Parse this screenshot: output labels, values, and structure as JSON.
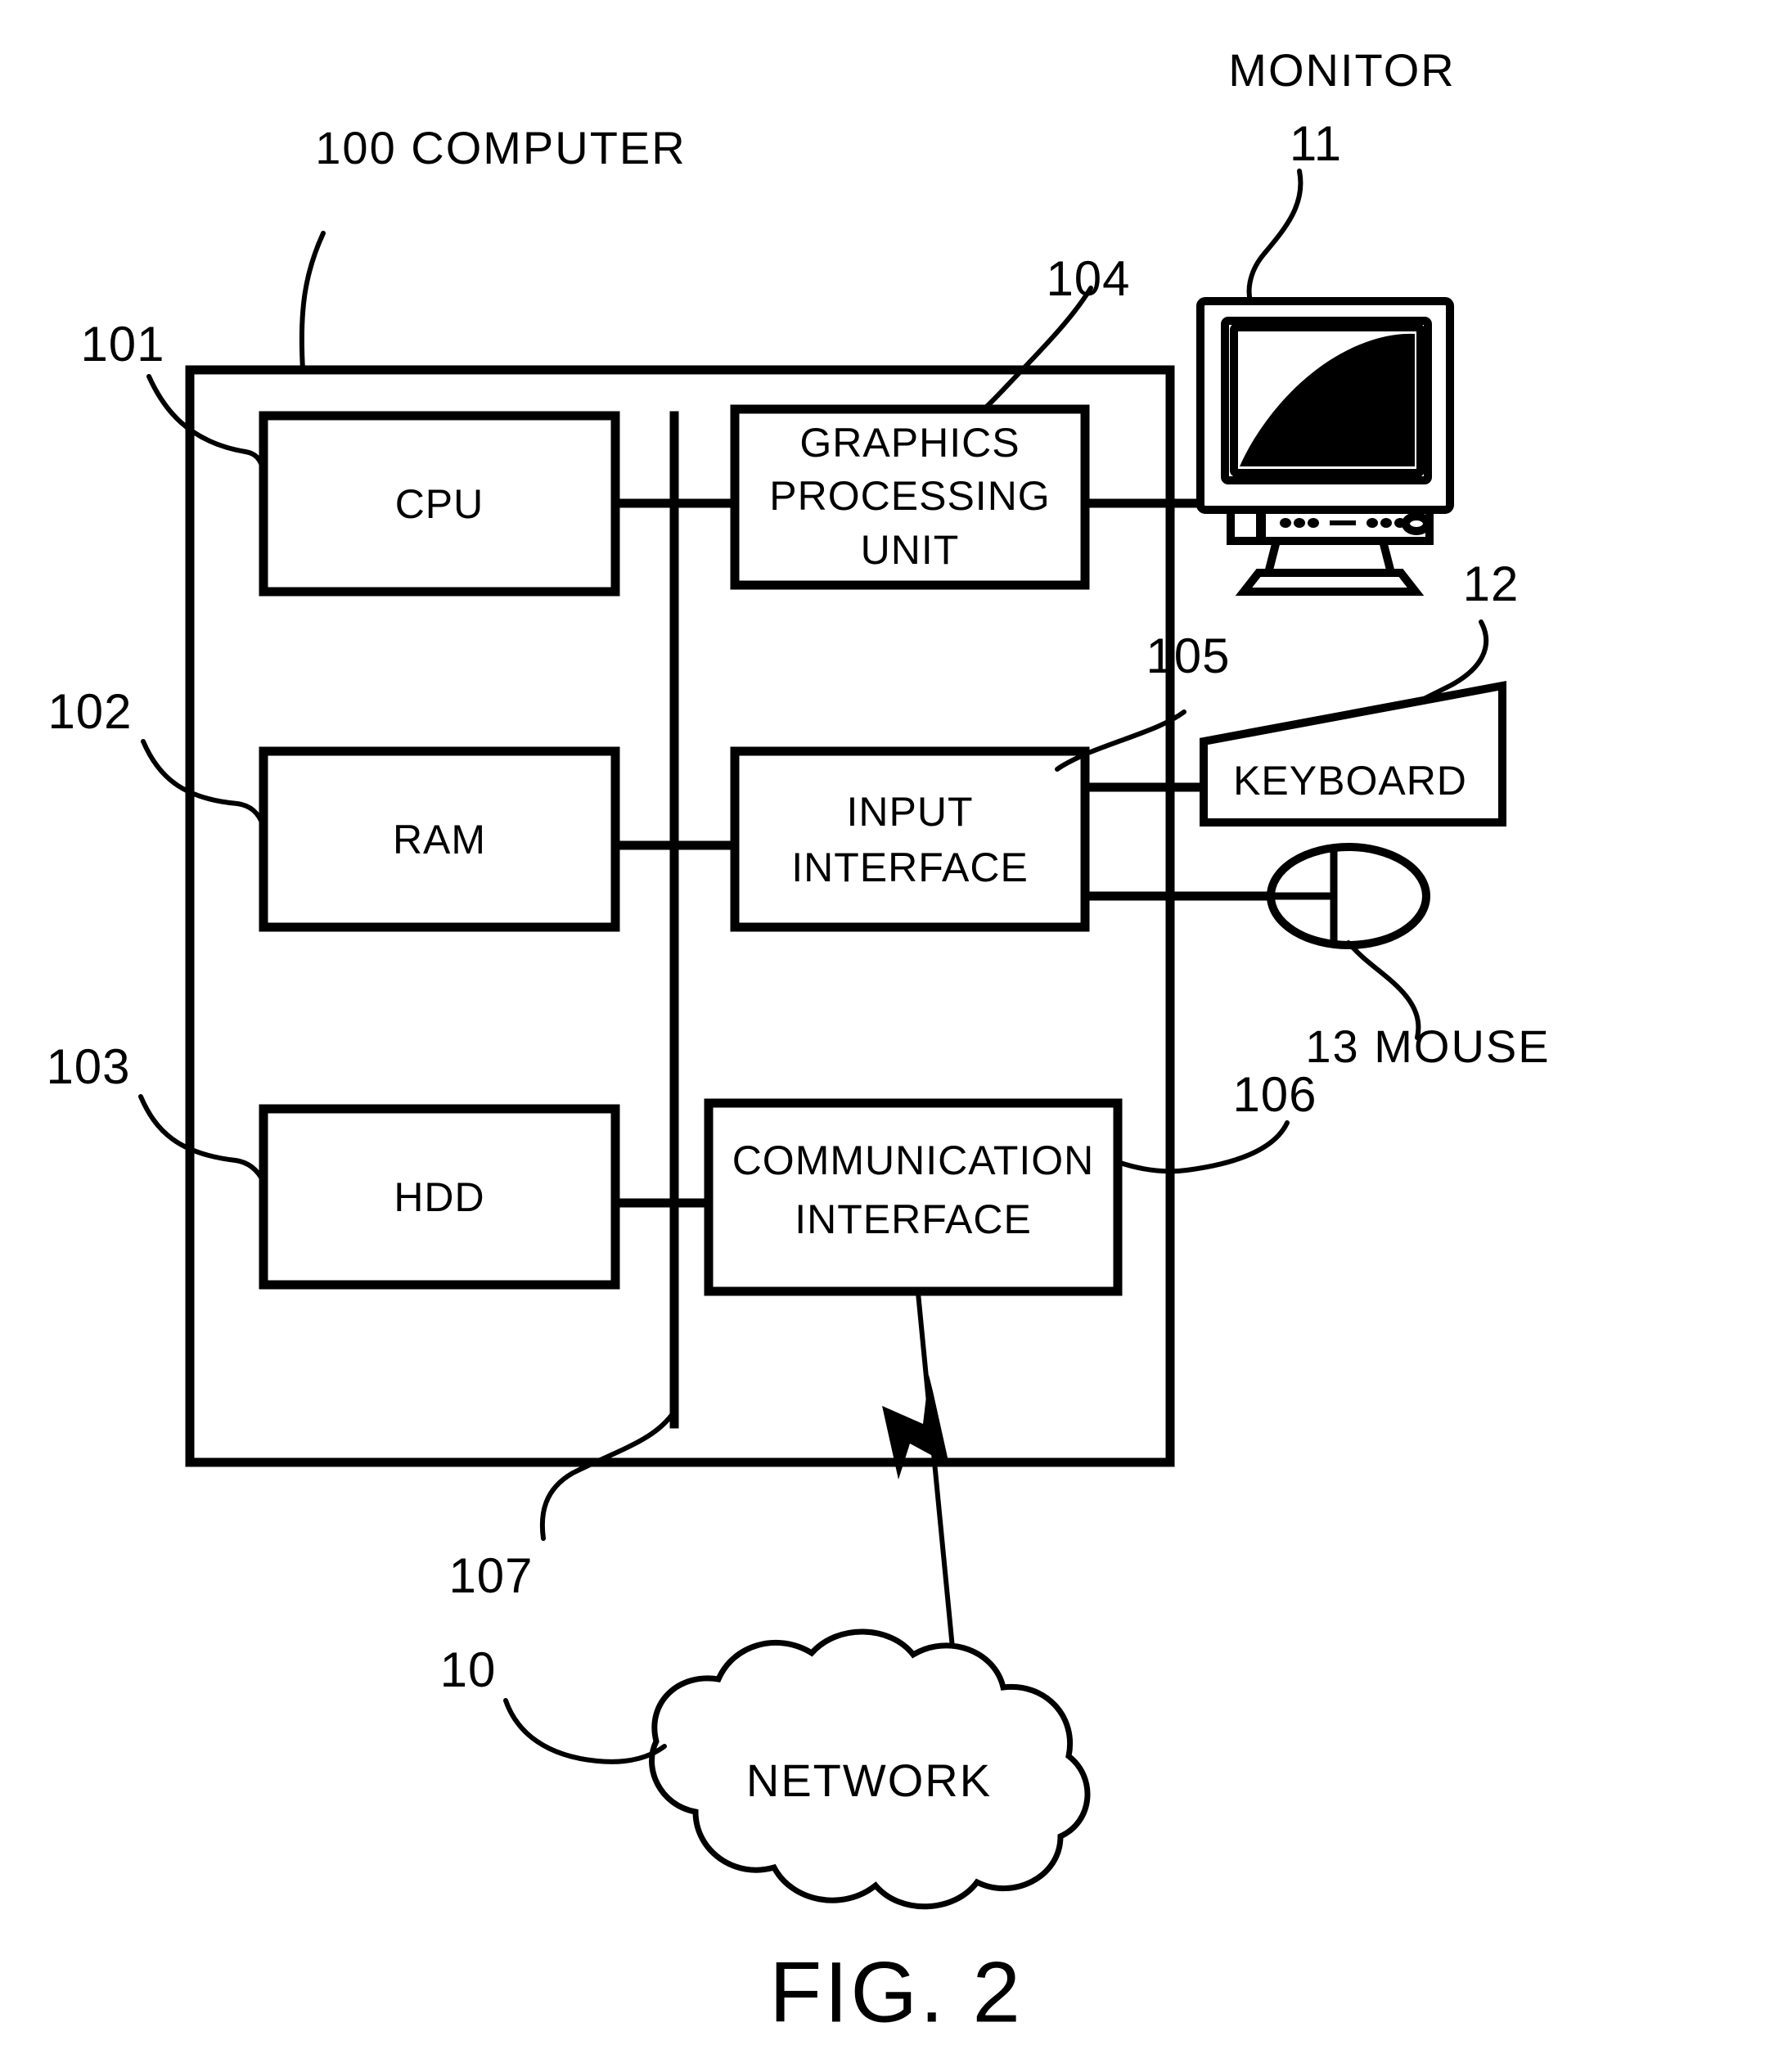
{
  "figure": {
    "caption": "FIG. 2"
  },
  "system": {
    "computer_ref": "100",
    "computer_label": "COMPUTER",
    "bus_ref": "107"
  },
  "blocks": [
    {
      "id": "cpu",
      "ref": "101",
      "label": "CPU",
      "lines": [
        "CPU"
      ]
    },
    {
      "id": "ram",
      "ref": "102",
      "label": "RAM",
      "lines": [
        "RAM"
      ]
    },
    {
      "id": "hdd",
      "ref": "103",
      "label": "HDD",
      "lines": [
        "HDD"
      ]
    },
    {
      "id": "gpu",
      "ref": "104",
      "label": "GRAPHICS PROCESSING UNIT",
      "lines": [
        "GRAPHICS",
        "PROCESSING",
        "UNIT"
      ]
    },
    {
      "id": "input",
      "ref": "105",
      "label": "INPUT INTERFACE",
      "lines": [
        "INPUT",
        "INTERFACE"
      ]
    },
    {
      "id": "comm",
      "ref": "106",
      "label": "COMMUNICATION INTERFACE",
      "lines": [
        "COMMUNICATION",
        "INTERFACE"
      ]
    }
  ],
  "peripherals": [
    {
      "id": "monitor",
      "ref": "11",
      "label": "MONITOR"
    },
    {
      "id": "keyboard",
      "ref": "12",
      "label": "KEYBOARD"
    },
    {
      "id": "mouse",
      "ref": "13",
      "label": "MOUSE"
    }
  ],
  "network": {
    "ref": "10",
    "label": "NETWORK"
  },
  "text": {
    "computer_callout": "100 COMPUTER",
    "monitor_callout": "MONITOR",
    "monitor_ref": "11",
    "keyboard_text": "KEYBOARD",
    "keyboard_ref": "12",
    "mouse_callout": "13 MOUSE",
    "network_text": "NETWORK",
    "network_ref": "10",
    "bus_ref": "107",
    "cpu_ref": "101",
    "ram_ref": "102",
    "hdd_ref": "103",
    "gpu_ref": "104",
    "input_ref": "105",
    "comm_ref": "106",
    "cpu_text": "CPU",
    "ram_text": "RAM",
    "hdd_text": "HDD",
    "gpu_line1": "GRAPHICS",
    "gpu_line2": "PROCESSING",
    "gpu_line3": "UNIT",
    "input_line1": "INPUT",
    "input_line2": "INTERFACE",
    "comm_line1": "COMMUNICATION",
    "comm_line2": "INTERFACE",
    "figure_caption": "FIG. 2"
  },
  "colors": {
    "ink": "#000000",
    "paper": "#ffffff"
  }
}
